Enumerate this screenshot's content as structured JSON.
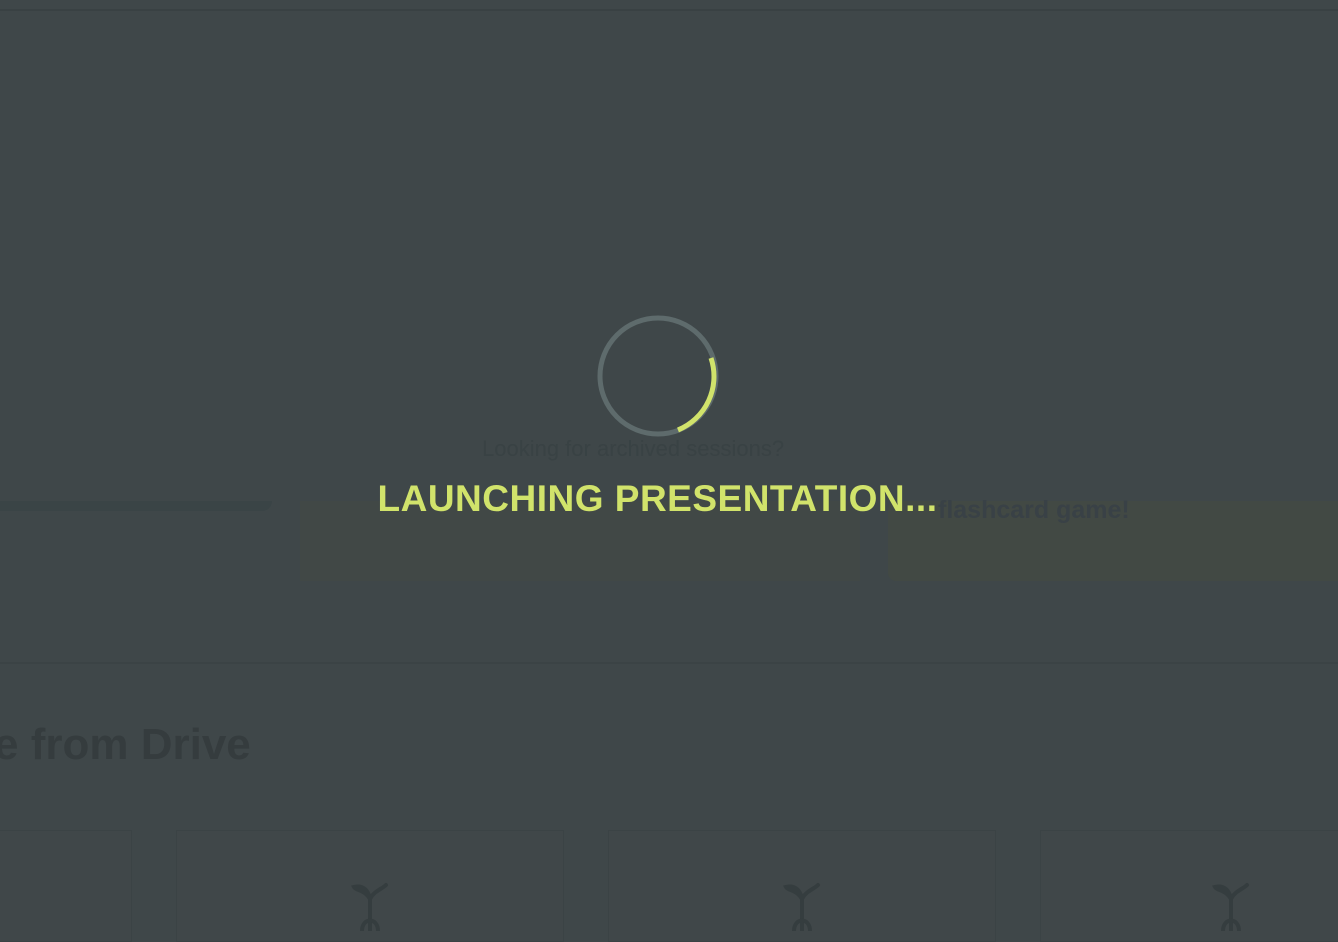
{
  "background": {
    "archived_text": "Looking for archived sessions?",
    "flashcard_text": "flashcard game!",
    "drive_heading": "e from Drive"
  },
  "overlay": {
    "status": "LAUNCHING PRESENTATION...",
    "spinner_color": "#d1e36b",
    "spinner_track_color": "#5e6b6c"
  },
  "cards": [
    {
      "icon": "plant-icon"
    },
    {
      "icon": "plant-icon"
    },
    {
      "icon": "plant-icon"
    }
  ]
}
